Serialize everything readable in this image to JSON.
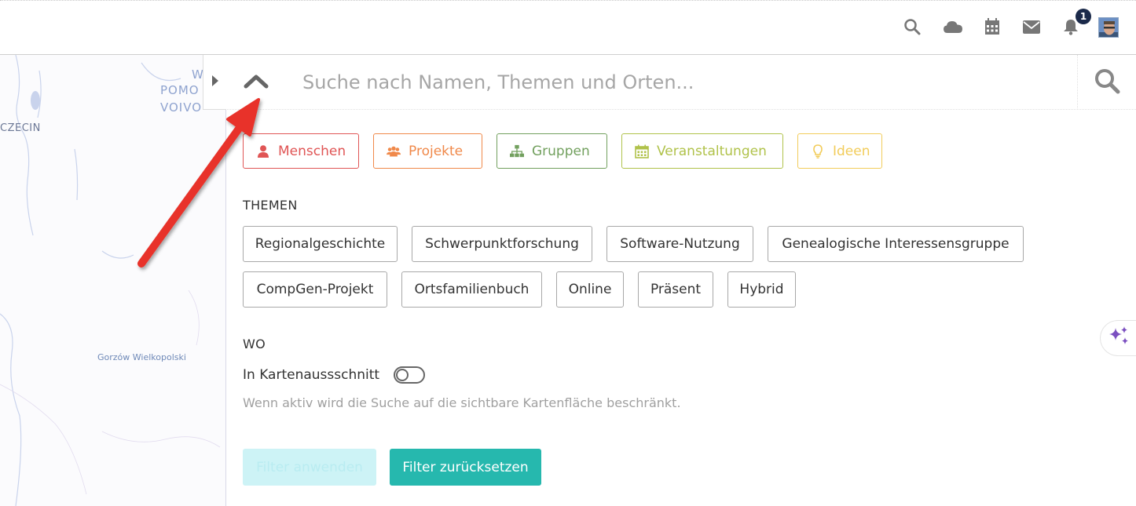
{
  "topbar": {
    "icons": [
      "search-icon",
      "cloud-icon",
      "calendar-icon",
      "mail-icon",
      "bell-icon"
    ],
    "notification_count": "1"
  },
  "map": {
    "labels": {
      "pomorskie": "POMO",
      "voivodeship": "VOIVO",
      "w": "W",
      "szczecin": "CZECIN",
      "gorzow": "Gorzów Wielkopolski"
    },
    "toggle_icon": "caret-right-icon"
  },
  "search": {
    "placeholder": "Suche nach Namen, Themen und Orten...",
    "collapse_icon": "chevron-up-icon",
    "search_icon": "search-icon"
  },
  "types": [
    {
      "label": "Menschen",
      "icon": "user-icon",
      "color": "#e05555"
    },
    {
      "label": "Projekte",
      "icon": "users-icon",
      "color": "#f0894a"
    },
    {
      "label": "Gruppen",
      "icon": "sitemap-icon",
      "color": "#72a05e"
    },
    {
      "label": "Veranstaltungen",
      "icon": "calendar-icon",
      "color": "#b0c24a"
    },
    {
      "label": "Ideen",
      "icon": "lightbulb-icon",
      "color": "#f2cc5a"
    }
  ],
  "themen": {
    "label": "THEMEN",
    "tags": [
      "Regionalgeschichte",
      "Schwerpunktforschung",
      "Software-Nutzung",
      "Genealogische Interessensgruppe",
      "CompGen-Projekt",
      "Ortsfamilienbuch",
      "Online",
      "Präsent",
      "Hybrid"
    ]
  },
  "wo": {
    "label": "WO",
    "toggle_label": "In Kartenaussschnitt",
    "hint": "Wenn aktiv wird die Suche auf die sichtbare Kartenfläche beschränkt."
  },
  "actions": {
    "apply": "Filter anwenden",
    "reset": "Filter zurücksetzen"
  },
  "colors": {
    "accent": "#26b8ae",
    "apply_disabled": "#cdf3f6",
    "arrow": "#e8332b",
    "sparkle": "#7b4fc0"
  }
}
